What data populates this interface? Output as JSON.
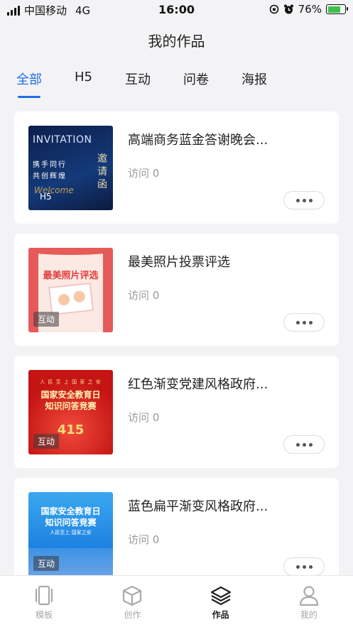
{
  "status": {
    "carrier": "中国移动",
    "network": "4G",
    "time": "16:00",
    "battery": "76%",
    "battery_level": 0.76
  },
  "header": {
    "title": "我的作品"
  },
  "tabs": [
    {
      "label": "全部",
      "active": true
    },
    {
      "label": "H5",
      "active": false
    },
    {
      "label": "互动",
      "active": false
    },
    {
      "label": "问卷",
      "active": false
    },
    {
      "label": "海报",
      "active": false
    }
  ],
  "works": [
    {
      "title": "高端商务蓝金答谢晚会...",
      "visits": "访问 0",
      "badge": "H5",
      "thumb": {
        "heading": "INVITATION",
        "line1": "携手同行",
        "line2": "共创辉煌",
        "vertical": "邀请函",
        "script": "Welcome"
      }
    },
    {
      "title": "最美照片投票评选",
      "visits": "访问 0",
      "badge": "互动",
      "thumb": {
        "heading": "最美照片评选"
      }
    },
    {
      "title": "红色渐变党建风格政府...",
      "visits": "访问 0",
      "badge": "互动",
      "thumb": {
        "small": "人 民 至 上 国 家 之 安",
        "line1": "国家安全教育日",
        "line2": "知识问答竞赛",
        "number": "415"
      }
    },
    {
      "title": "蓝色扁平渐变风格政府...",
      "visits": "访问 0",
      "badge": "互动",
      "thumb": {
        "line1": "国家安全教育日",
        "line2": "知识问答竞赛",
        "line3": "人民至上 国家之安"
      }
    }
  ],
  "tabbar": [
    {
      "label": "模板",
      "icon": "phone-template-icon",
      "active": false
    },
    {
      "label": "创作",
      "icon": "cube-icon",
      "active": false
    },
    {
      "label": "作品",
      "icon": "layers-icon",
      "active": true
    },
    {
      "label": "我的",
      "icon": "user-icon",
      "active": false
    }
  ],
  "colors": {
    "accent": "#1f6fe5",
    "background": "#f3f3f6"
  }
}
